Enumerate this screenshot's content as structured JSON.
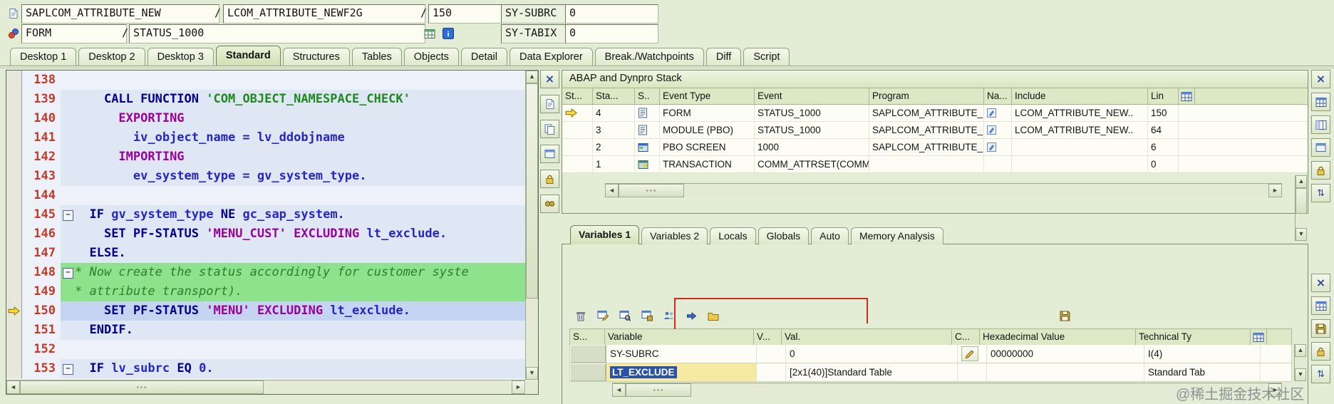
{
  "window": {
    "watermark": "@稀土掘金技术社区"
  },
  "glyphs": {
    "up": "▲",
    "down": "▼",
    "left": "◄",
    "right": "►",
    "grip": "···",
    "fold": "−"
  },
  "header": {
    "sep": "/",
    "program": "SAPLCOM_ATTRIBUTE_NEW",
    "include": "LCOM_ATTRIBUTE_NEWF2G",
    "line": "150",
    "sy_subrc": {
      "label": "SY-SUBRC",
      "value": "0"
    },
    "event_type": "FORM",
    "event": "STATUS_1000",
    "sy_tabix": {
      "label": "SY-TABIX",
      "value": "0"
    }
  },
  "desktop_tabs": {
    "active": "Standard",
    "items": [
      "Desktop 1",
      "Desktop 2",
      "Desktop 3",
      "Standard",
      "Structures",
      "Tables",
      "Objects",
      "Detail",
      "Data Explorer",
      "Break./Watchpoints",
      "Diff",
      "Script"
    ]
  },
  "code": {
    "lines": [
      {
        "num": "138",
        "style": "plain",
        "parts": []
      },
      {
        "num": "139",
        "style": "shade",
        "parts": [
          [
            "pl",
            "    "
          ],
          [
            "kw",
            "CALL FUNCTION"
          ],
          [
            "pl",
            " "
          ],
          [
            "str",
            "'COM_OBJECT_NAMESPACE_CHECK'"
          ]
        ]
      },
      {
        "num": "140",
        "style": "shade",
        "parts": [
          [
            "pl",
            "      "
          ],
          [
            "kw2",
            "EXPORTING"
          ]
        ]
      },
      {
        "num": "141",
        "style": "shade",
        "parts": [
          [
            "pl",
            "        "
          ],
          [
            "id",
            "iv_object_name"
          ],
          [
            "pl",
            " = "
          ],
          [
            "id",
            "lv_ddobjname"
          ]
        ]
      },
      {
        "num": "142",
        "style": "shade",
        "parts": [
          [
            "pl",
            "      "
          ],
          [
            "kw2",
            "IMPORTING"
          ]
        ]
      },
      {
        "num": "143",
        "style": "shade",
        "parts": [
          [
            "pl",
            "        "
          ],
          [
            "id",
            "ev_system_type"
          ],
          [
            "pl",
            " = "
          ],
          [
            "id",
            "gv_system_type."
          ]
        ]
      },
      {
        "num": "144",
        "style": "plain",
        "parts": []
      },
      {
        "num": "145",
        "style": "shade",
        "fold": true,
        "parts": [
          [
            "pl",
            "  "
          ],
          [
            "kw",
            "IF"
          ],
          [
            "pl",
            " "
          ],
          [
            "id",
            "gv_system_type"
          ],
          [
            "pl",
            " "
          ],
          [
            "kw",
            "NE"
          ],
          [
            "pl",
            " "
          ],
          [
            "id",
            "gc_sap_system."
          ]
        ]
      },
      {
        "num": "146",
        "style": "shade",
        "parts": [
          [
            "pl",
            "    "
          ],
          [
            "kw",
            "SET PF-STATUS"
          ],
          [
            "pl",
            " "
          ],
          [
            "str2",
            "'MENU_CUST'"
          ],
          [
            "pl",
            " "
          ],
          [
            "kw2",
            "EXCLUDING"
          ],
          [
            "pl",
            " "
          ],
          [
            "id",
            "lt_exclude."
          ]
        ]
      },
      {
        "num": "147",
        "style": "shade",
        "parts": [
          [
            "pl",
            "  "
          ],
          [
            "kw",
            "ELSE."
          ]
        ]
      },
      {
        "num": "148",
        "style": "comment",
        "fold": true,
        "parts": [
          [
            "com",
            "* Now create the status accordingly for customer syste"
          ]
        ]
      },
      {
        "num": "149",
        "style": "comment",
        "parts": [
          [
            "com",
            "* attribute transport)."
          ]
        ]
      },
      {
        "num": "150",
        "style": "current",
        "parts": [
          [
            "pl",
            "    "
          ],
          [
            "kw",
            "SET PF-STATUS"
          ],
          [
            "pl",
            " "
          ],
          [
            "str2",
            "'MENU'"
          ],
          [
            "pl",
            " "
          ],
          [
            "kw2",
            "EXCLUDING"
          ],
          [
            "pl",
            " "
          ],
          [
            "id",
            "lt_exclude."
          ]
        ]
      },
      {
        "num": "151",
        "style": "shade",
        "parts": [
          [
            "pl",
            "  "
          ],
          [
            "kw",
            "ENDIF."
          ]
        ]
      },
      {
        "num": "152",
        "style": "plain",
        "parts": []
      },
      {
        "num": "153",
        "style": "shade",
        "fold": true,
        "parts": [
          [
            "pl",
            "  "
          ],
          [
            "kw",
            "IF"
          ],
          [
            "pl",
            " "
          ],
          [
            "id",
            "lv_subrc"
          ],
          [
            "pl",
            " "
          ],
          [
            "kw",
            "EQ"
          ],
          [
            "pl",
            " "
          ],
          [
            "id",
            "0."
          ]
        ]
      }
    ]
  },
  "stack": {
    "title": "ABAP and Dynpro Stack",
    "columns": [
      "St...",
      "Sta...",
      "S..",
      "Event Type",
      "Event",
      "Program",
      "Na...",
      "Include",
      "Lin"
    ],
    "rows": [
      {
        "current": true,
        "level": "4",
        "type_icon": "form-event-icon",
        "event_type": "FORM",
        "event": "STATUS_1000",
        "program": "SAPLCOM_ATTRIBUTE_..",
        "nav": true,
        "include": "LCOM_ATTRIBUTE_NEW..",
        "line": "150"
      },
      {
        "current": false,
        "level": "3",
        "type_icon": "module-event-icon",
        "event_type": "MODULE (PBO)",
        "event": "STATUS_1000",
        "program": "SAPLCOM_ATTRIBUTE_..",
        "nav": true,
        "include": "LCOM_ATTRIBUTE_NEW..",
        "line": "64"
      },
      {
        "current": false,
        "level": "2",
        "type_icon": "screen-event-icon",
        "event_type": "PBO SCREEN",
        "event": "1000",
        "program": "SAPLCOM_ATTRIBUTE_..",
        "nav": true,
        "include": "",
        "line": "6"
      },
      {
        "current": false,
        "level": "1",
        "type_icon": "transaction-event-icon",
        "event_type": "TRANSACTION",
        "event": "COMM_ATTRSET(COMM..",
        "program": "",
        "nav": false,
        "include": "",
        "line": "0"
      }
    ]
  },
  "variables": {
    "active_tab": "Variables 1",
    "tabs": [
      "Variables 1",
      "Variables 2",
      "Locals",
      "Globals",
      "Auto",
      "Memory Analysis"
    ],
    "columns": [
      "S...",
      "Variable",
      "V...",
      "Val.",
      "C...",
      "Hexadecimal Value",
      "Technical Ty"
    ],
    "rows": [
      {
        "variable": "SY-SUBRC",
        "val": "0",
        "editable": true,
        "hex": "00000000",
        "tech": "I(4)",
        "selected": false
      },
      {
        "variable": "LT_EXCLUDE",
        "val": "[2x1(40)]Standard Table",
        "editable": false,
        "hex": "",
        "tech": "Standard Tab",
        "selected": true
      }
    ]
  },
  "icons": {
    "mode-icon": "doc",
    "debugger-icon": "gears",
    "layout-icon": "tablegreen",
    "info-icon": "info",
    "close-icon": "close",
    "new-page-icon": "doc",
    "copy-page-icon": "docs",
    "detach-view-icon": "window",
    "lock-icon": "lock",
    "watchpoint-icon": "watch",
    "table-settings-icon": "tableblue",
    "choose-columns-icon": "columns",
    "detail-view-icon": "window",
    "sort-icon": "sort",
    "save-layout-icon": "disk",
    "delete-variables-icon": "trash",
    "change-variable-icon": "tblpencil",
    "display-variable-icon": "tblview",
    "save-variable-icon": "tbldisk",
    "compare-variables-icon": "people",
    "goto-icon": "goto",
    "services-icon": "folder",
    "form-event-icon": "doc2",
    "module-event-icon": "doc2",
    "screen-event-icon": "screen",
    "transaction-event-icon": "transaction",
    "nav-icon": "nav",
    "pencil-icon": "pencil",
    "current-line-arrow": "arrow"
  },
  "strips": {
    "code": [
      "close-icon",
      "new-page-icon",
      "copy-page-icon",
      "detach-view-icon",
      "lock-icon",
      "watchpoint-icon"
    ],
    "stack_panel": [
      "close-icon",
      "table-settings-icon",
      "choose-columns-icon",
      "detail-view-icon",
      "lock-icon",
      "sort-icon"
    ],
    "vars_panel": [
      "close-icon",
      "table-settings-icon",
      "save-layout-icon",
      "lock-icon",
      "sort-icon"
    ],
    "vars_toolbar": [
      "delete-variables-icon",
      "change-variable-icon",
      "display-variable-icon",
      "save-variable-icon",
      "compare-variables-icon",
      "goto-icon",
      "services-icon"
    ]
  }
}
